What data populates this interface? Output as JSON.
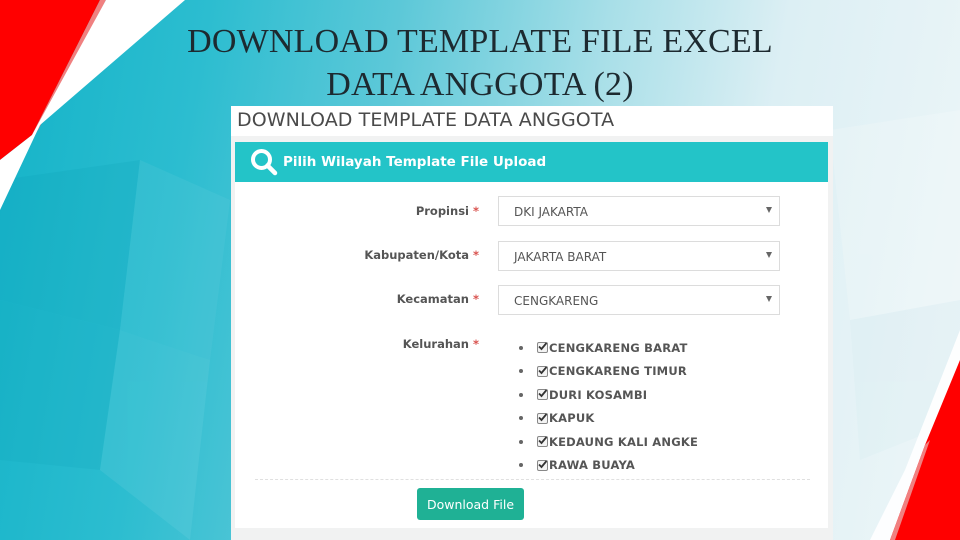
{
  "slide": {
    "title_line1": "DOWNLOAD TEMPLATE FILE EXCEL",
    "title_line2": "DATA ANGGOTA (2)"
  },
  "page": {
    "header_title": "DOWNLOAD TEMPLATE DATA ANGGOTA"
  },
  "card": {
    "icon": "search-icon",
    "title": "Pilih Wilayah Template File Upload",
    "accent_color": "#23c4c8"
  },
  "form": {
    "required_mark": "*",
    "propinsi": {
      "label": "Propinsi",
      "value": "DKI JAKARTA"
    },
    "kabupaten": {
      "label": "Kabupaten/Kota",
      "value": "JAKARTA BARAT"
    },
    "kecamatan": {
      "label": "Kecamatan",
      "value": "CENGKARENG"
    },
    "kelurahan": {
      "label": "Kelurahan",
      "options": [
        {
          "label": "CENGKARENG BARAT",
          "checked": true
        },
        {
          "label": "CENGKARENG TIMUR",
          "checked": true
        },
        {
          "label": "DURI KOSAMBI",
          "checked": true
        },
        {
          "label": "KAPUK",
          "checked": true
        },
        {
          "label": "KEDAUNG KALI ANGKE",
          "checked": true
        },
        {
          "label": "RAWA BUAYA",
          "checked": true
        }
      ]
    }
  },
  "actions": {
    "download_label": "Download File",
    "download_color": "#1fb195"
  }
}
